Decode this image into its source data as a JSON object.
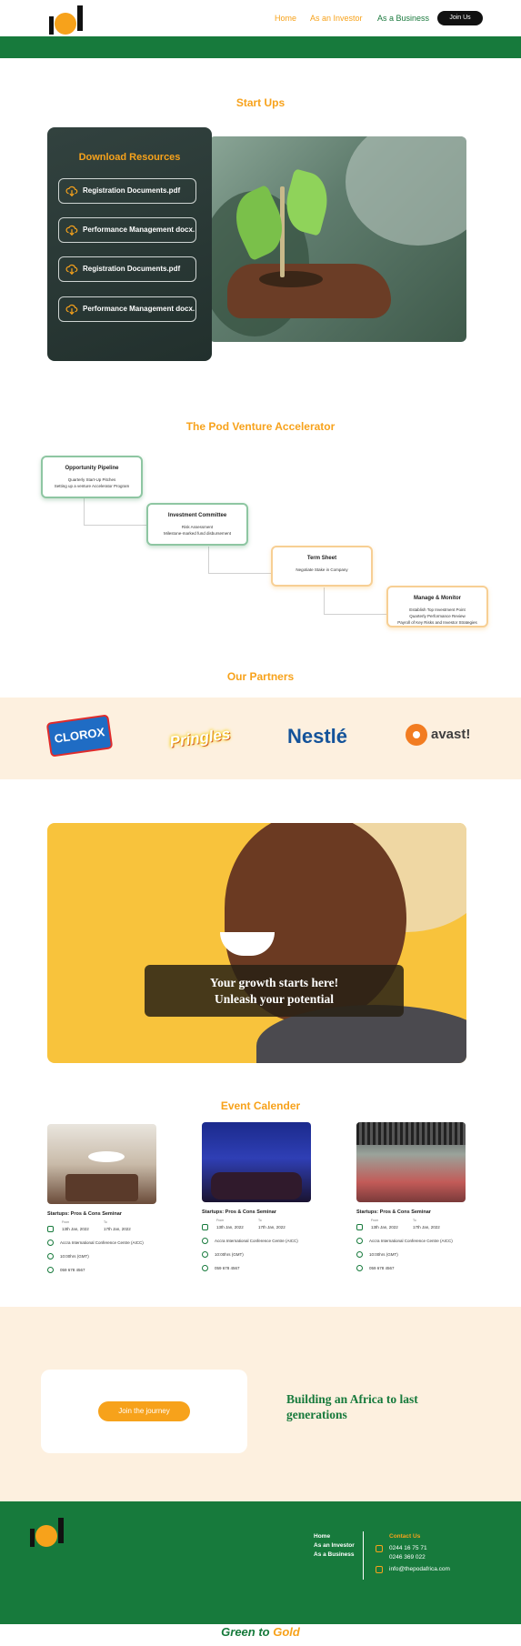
{
  "header": {
    "nav": [
      "Home",
      "As an Investor",
      "As a Business"
    ],
    "join_button": "Join Us"
  },
  "startups": {
    "title": "Start Ups",
    "download_title": "Download Resources",
    "resources": [
      "Registration Documents.pdf",
      "Performance Management docx.",
      "Registration Documents.pdf",
      "Performance Management docx."
    ]
  },
  "accelerator": {
    "title": "The Pod Venture Accelerator",
    "cards": [
      {
        "title": "Opportunity Pipeline",
        "lines": [
          "Quarterly Start-Up Pitches",
          "Setting up a venture Accelerator Program"
        ]
      },
      {
        "title": "Investment Committee",
        "lines": [
          "Risk Assessment",
          "Milestone-marked fund disbursement"
        ]
      },
      {
        "title": "Term Sheet",
        "lines": [
          "Negotiate Stake in Company"
        ]
      },
      {
        "title": "Manage & Monitor",
        "lines": [
          "Establish Top Investment Point",
          "Quarterly Performance Review",
          "Payroll of Key Risks and Investor Strategies"
        ]
      }
    ]
  },
  "partners": {
    "title": "Our Partners",
    "logos": [
      "CLOROX",
      "Pringles",
      "Nestlé",
      "avast!"
    ]
  },
  "hero": {
    "line1": "Your growth starts here!",
    "line2": "Unleash  your potential"
  },
  "events": {
    "title": "Event Calender",
    "items": [
      {
        "title": "Startups: Pros & Cons Seminar",
        "from_label": "From",
        "to_label": "To",
        "from": "13th Jan, 2022",
        "to": "17th Jan, 2022",
        "venue": "Accra International Conference Centre (AICC)",
        "time": "10:00hrs (GMT)",
        "phone": "059 678 4567"
      },
      {
        "title": "Startups: Pros & Cons Seminar",
        "from_label": "From",
        "to_label": "To",
        "from": "13th Jan, 2022",
        "to": "17th Jan, 2022",
        "venue": "Accra International Conference Centre (AICC)",
        "time": "10:00hrs (GMT)",
        "phone": "059 678 4567"
      },
      {
        "title": "Startups: Pros & Cons Seminar",
        "from_label": "From",
        "to_label": "To",
        "from": "13th Jan, 2022",
        "to": "17th Jan, 2022",
        "venue": "Accra International Conference Centre (AICC)",
        "time": "10:00hrs (GMT)",
        "phone": "059 678 4567"
      }
    ]
  },
  "journey": {
    "button": "Join the journey",
    "text": "Building an Africa to last generations"
  },
  "footer": {
    "links": [
      "Home",
      "As an Investor",
      "As a Business"
    ],
    "contact_title": "Contact Us",
    "phone1": "0244 16 75 71",
    "phone2": "0246 369 022",
    "email": "info@thepodafrica.com"
  },
  "tagline": {
    "green": "Green",
    "to": " to ",
    "gold": "Gold"
  },
  "colors": {
    "brand_green": "#177a3c",
    "brand_orange": "#f7a21b",
    "cream": "#fdf0df"
  }
}
